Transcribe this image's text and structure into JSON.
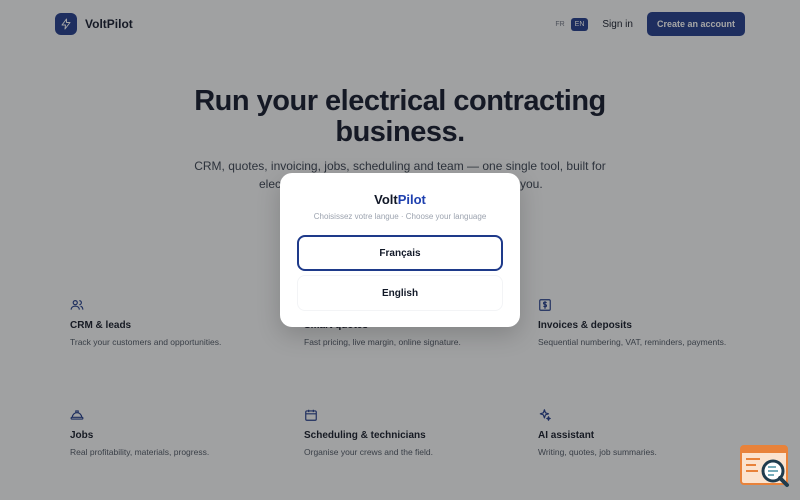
{
  "header": {
    "brand": "VoltPilot",
    "lang_fr": "FR",
    "lang_en": "EN",
    "signin": "Sign in",
    "cta": "Create an account"
  },
  "hero": {
    "title_line1": "Run your electrical contracting",
    "title_line2": "business.",
    "subtitle_line1": "CRM, quotes, invoicing, jobs, scheduling and team — one single tool, built for",
    "subtitle_line2": "elec",
    "subtitle_tail": "you."
  },
  "features": [
    {
      "icon": "users-icon",
      "title": "CRM & leads",
      "desc": "Track your customers and opportunities."
    },
    {
      "icon": "quote-icon",
      "title": "Smart quotes",
      "desc": "Fast pricing, live margin, online signature."
    },
    {
      "icon": "invoice-icon",
      "title": "Invoices & deposits",
      "desc": "Sequential numbering, VAT, reminders, payments."
    },
    {
      "icon": "hardhat-icon",
      "title": "Jobs",
      "desc": "Real profitability, materials, progress."
    },
    {
      "icon": "calendar-icon",
      "title": "Scheduling & technicians",
      "desc": "Organise your crews and the field."
    },
    {
      "icon": "sparkle-icon",
      "title": "AI assistant",
      "desc": "Writing, quotes, job summaries."
    }
  ],
  "modal": {
    "brand_part1": "Volt",
    "brand_part2": "Pilot",
    "subtitle": "Choisissez votre langue · Choose your language",
    "option_fr": "Français",
    "option_en": "English"
  },
  "colors": {
    "primary": "#1e3a8a",
    "accent": "#1e40af",
    "badge": "#e8823a"
  }
}
